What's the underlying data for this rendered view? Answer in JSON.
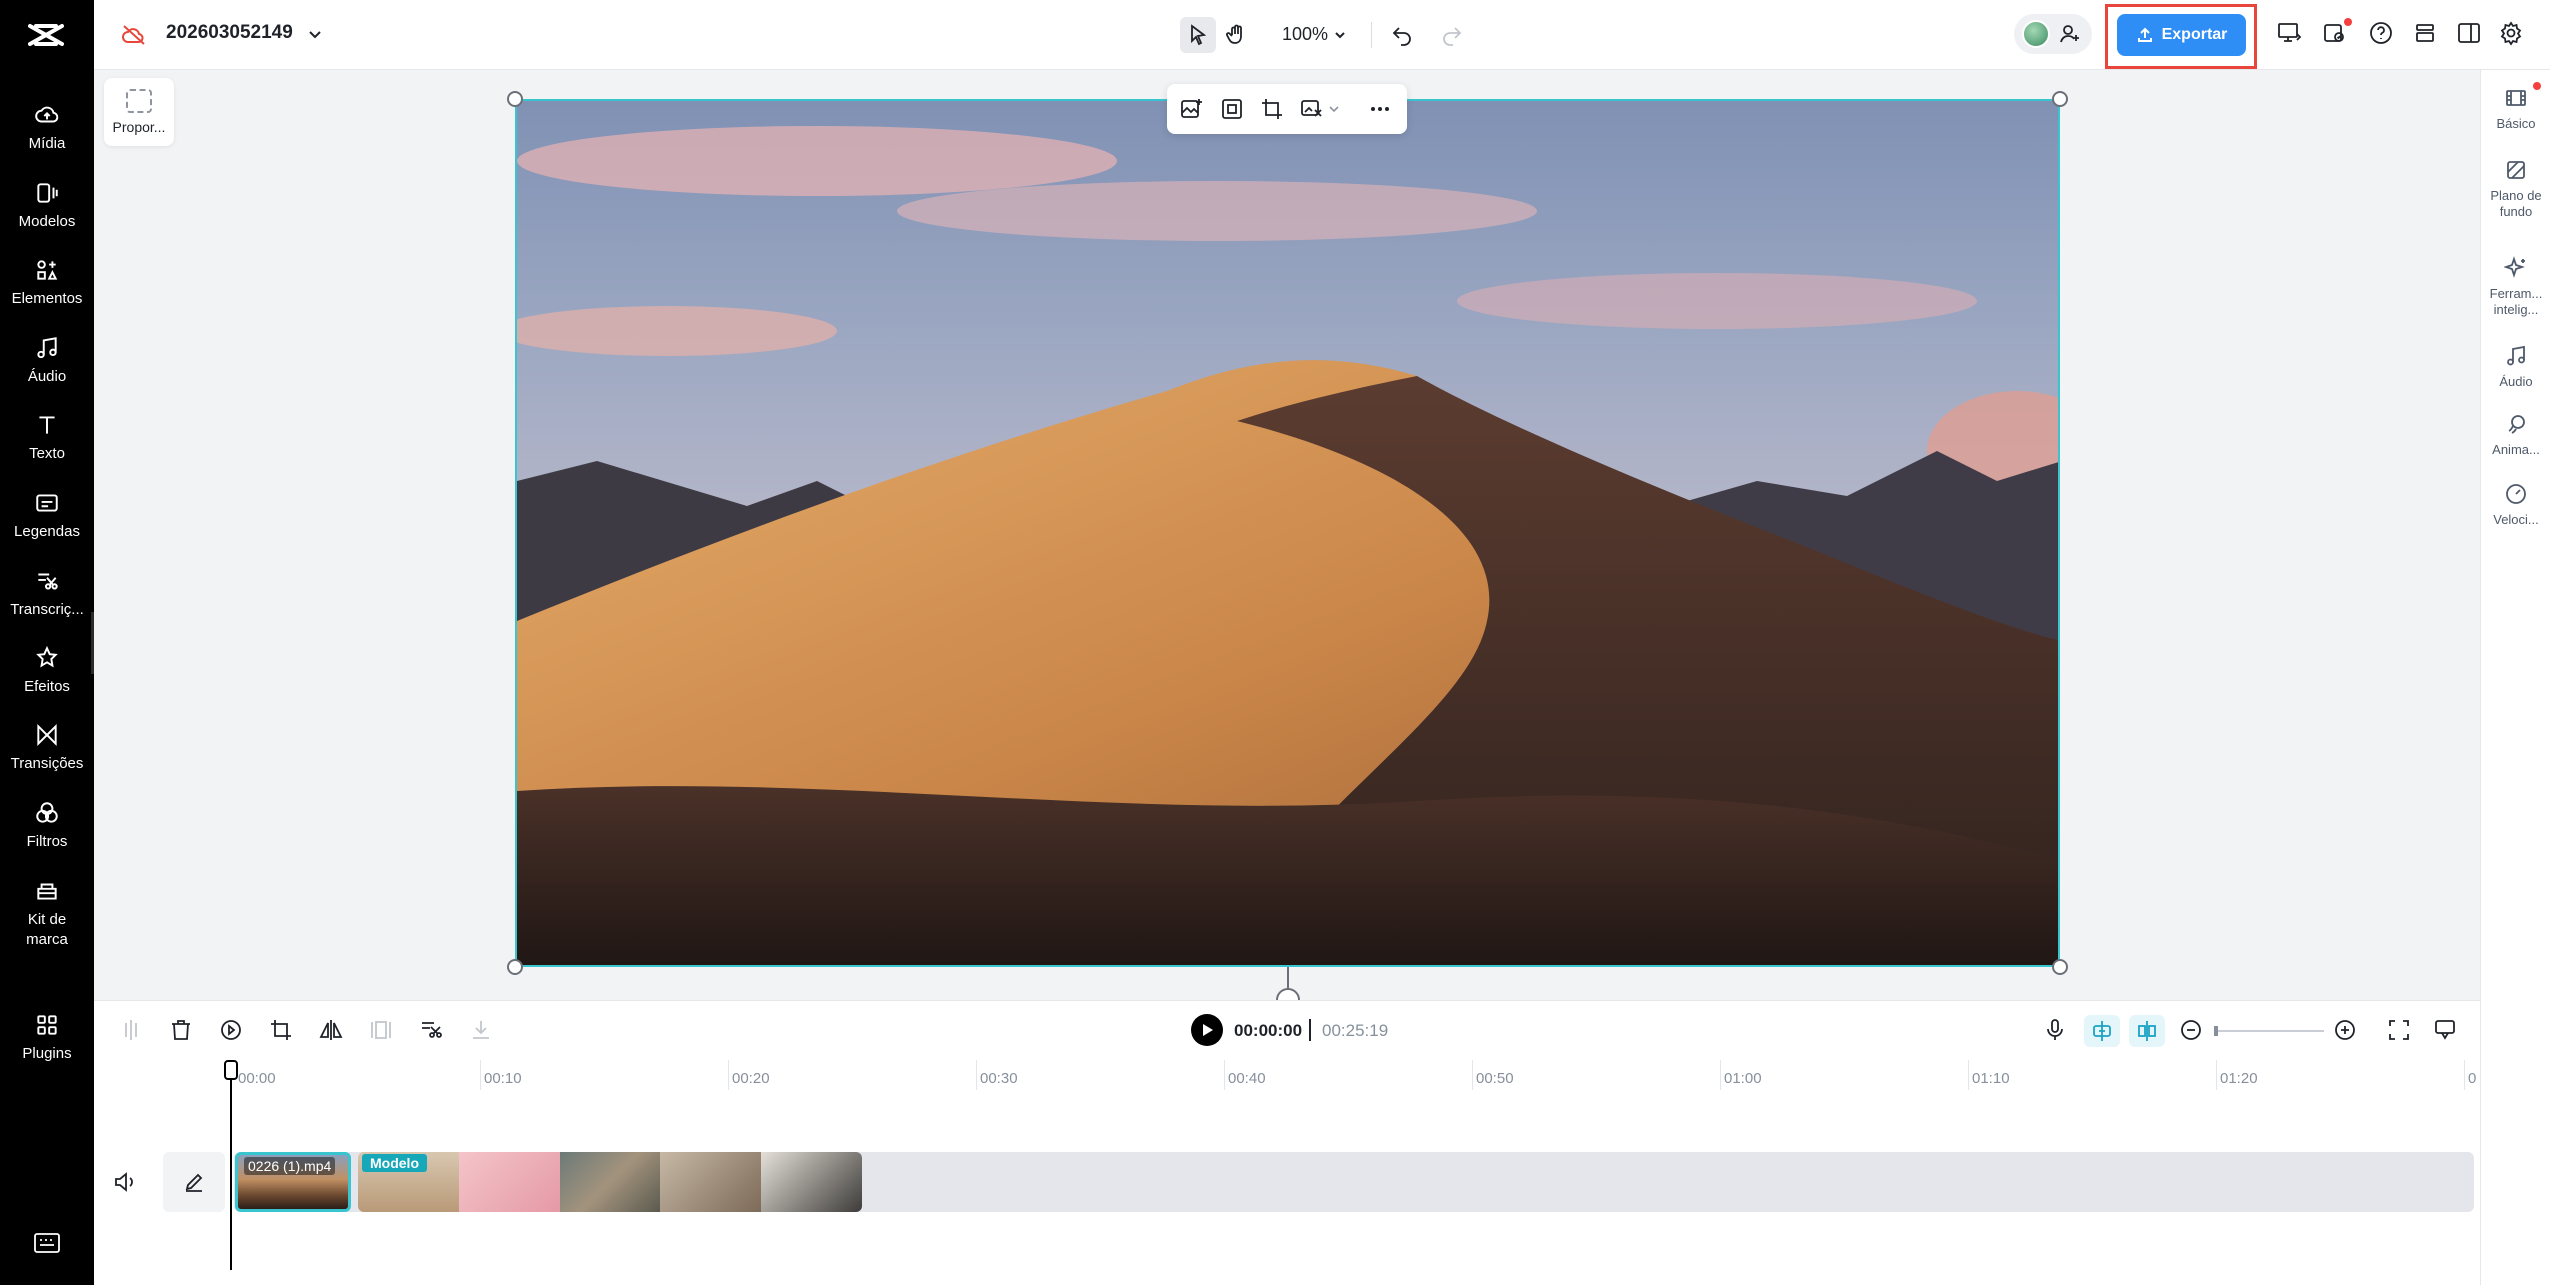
{
  "project": {
    "name": "202603052149"
  },
  "toolbar": {
    "zoom": "100%",
    "export_label": "Exportar"
  },
  "sidebar": {
    "items": [
      {
        "label": "Mídia",
        "icon": "cloud-upload-icon"
      },
      {
        "label": "Modelos",
        "icon": "template-icon"
      },
      {
        "label": "Elementos",
        "icon": "elements-icon"
      },
      {
        "label": "Áudio",
        "icon": "music-note-icon"
      },
      {
        "label": "Texto",
        "icon": "text-icon"
      },
      {
        "label": "Legendas",
        "icon": "captions-icon"
      },
      {
        "label": "Transcriç...",
        "icon": "transcript-icon"
      },
      {
        "label": "Efeitos",
        "icon": "effects-icon"
      },
      {
        "label": "Transições",
        "icon": "transitions-icon"
      },
      {
        "label": "Filtros",
        "icon": "filters-icon"
      },
      {
        "label": "Kit de marca",
        "icon": "brand-kit-icon"
      },
      {
        "label": "Plugins",
        "icon": "plugins-icon"
      }
    ]
  },
  "canvas": {
    "ratio_label": "Propor..."
  },
  "right_panel": {
    "items": [
      {
        "label": "Básico",
        "icon": "basic-icon"
      },
      {
        "label": "Plano de fundo",
        "icon": "background-icon"
      },
      {
        "label": "Ferram... intelig...",
        "icon": "ai-tools-icon"
      },
      {
        "label": "Áudio",
        "icon": "audio-icon"
      },
      {
        "label": "Anima...",
        "icon": "animation-icon"
      },
      {
        "label": "Veloci...",
        "icon": "speed-icon"
      }
    ]
  },
  "playback": {
    "current": "00:00:00",
    "total": "00:25:19"
  },
  "timeline": {
    "ticks": [
      "00:00",
      "00:10",
      "00:20",
      "00:30",
      "00:40",
      "00:50",
      "01:00",
      "01:10",
      "01:20",
      "0"
    ],
    "main_clip_label": "0226 (1).mp4",
    "template_label": "Modelo"
  },
  "colors": {
    "accent": "#2f8ef6",
    "selection": "#39c5cf",
    "highlight": "#e8463a"
  }
}
